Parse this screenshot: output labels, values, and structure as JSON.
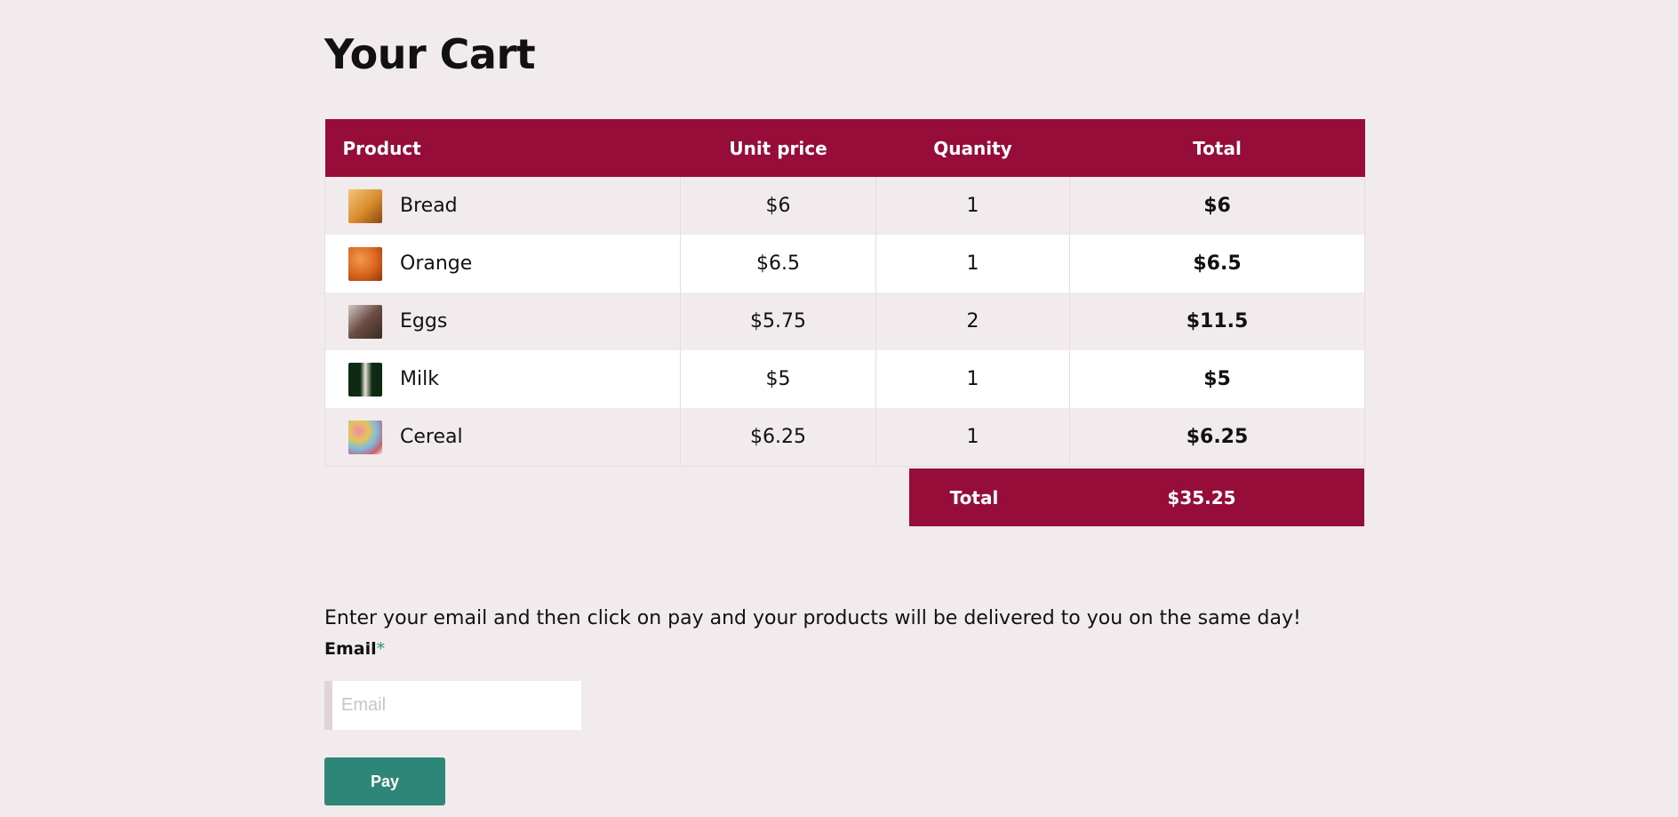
{
  "page": {
    "title": "Your Cart"
  },
  "table": {
    "headers": {
      "product": "Product",
      "unit_price": "Unit price",
      "quantity": "Quanity",
      "total": "Total"
    },
    "rows": [
      {
        "name": "Bread",
        "price": "$6",
        "qty": "1",
        "total": "$6",
        "icon": "bread-thumbnail"
      },
      {
        "name": "Orange",
        "price": "$6.5",
        "qty": "1",
        "total": "$6.5",
        "icon": "orange-thumbnail"
      },
      {
        "name": "Eggs",
        "price": "$5.75",
        "qty": "2",
        "total": "$11.5",
        "icon": "eggs-thumbnail"
      },
      {
        "name": "Milk",
        "price": "$5",
        "qty": "1",
        "total": "$5",
        "icon": "milk-thumbnail"
      },
      {
        "name": "Cereal",
        "price": "$6.25",
        "qty": "1",
        "total": "$6.25",
        "icon": "cereal-thumbnail"
      }
    ]
  },
  "summary": {
    "label": "Total",
    "value": "$35.25"
  },
  "checkout": {
    "info_text": "Enter your email and then click on pay and your products will be delivered to you on the same day!",
    "email_label": "Email",
    "required_marker": "*",
    "email_placeholder": "Email",
    "email_value": "",
    "pay_label": "Pay"
  },
  "colors": {
    "header_bg": "#970d3a",
    "accent": "#2e8679",
    "page_bg": "#f2ebee"
  }
}
